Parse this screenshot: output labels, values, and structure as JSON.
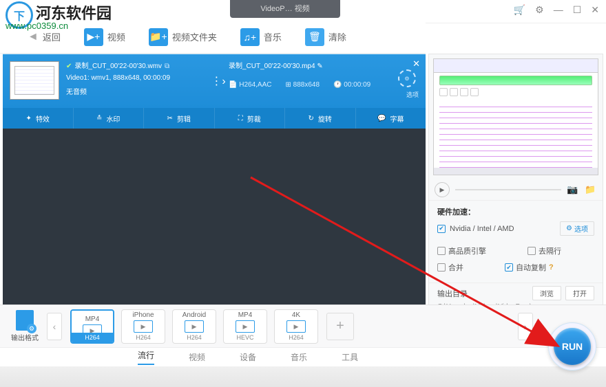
{
  "watermark": {
    "logo_text": "下",
    "title": "河东软件园",
    "url": "www.pc0359.cn"
  },
  "titlebar": {
    "center": "VideoP… 视频"
  },
  "toolbar": {
    "back": "返回",
    "video": "视频",
    "video_folder": "视频文件夹",
    "music": "音乐",
    "clear": "清除"
  },
  "media": {
    "src_name": "录制_CUT_00'22-00'30.wmv",
    "src_info": "Video1: wmv1, 888x648, 00:00:09",
    "src_audio": "无音频",
    "tgt_name": "录制_CUT_00'22-00'30.mp4",
    "tgt_codec": "H264,AAC",
    "tgt_res": "888x648",
    "tgt_dur": "00:00:09",
    "codec_label": "选项",
    "tools": {
      "fx": "特效",
      "wm": "水印",
      "cut": "剪辑",
      "crop": "剪裁",
      "rotate": "旋转",
      "sub": "字幕"
    }
  },
  "right": {
    "hw_title": "硬件加速：",
    "hw_vendor": "Nvidia / Intel / AMD",
    "hw_opt": "选项",
    "opts": {
      "hq": "高品质引擎",
      "deint": "去隔行",
      "merge": "合并",
      "autocopy": "自动复制",
      "q": "?"
    },
    "out_title": "输出目录",
    "out_browse": "浏览",
    "out_open": "打开",
    "out_path": "C:\\Users\\pc\\Videos\\VideoProc\\"
  },
  "formats": {
    "label": "输出格式",
    "items": [
      {
        "top": "MP4",
        "bot": "H264",
        "sel": true
      },
      {
        "top": "iPhone",
        "bot": "H264",
        "sel": false
      },
      {
        "top": "Android",
        "bot": "H264",
        "sel": false
      },
      {
        "top": "MP4",
        "bot": "HEVC",
        "sel": false
      },
      {
        "top": "4K",
        "bot": "H264",
        "sel": false
      }
    ]
  },
  "tabs": {
    "popular": "流行",
    "video": "视频",
    "device": "设备",
    "music": "音乐",
    "tool": "工具"
  },
  "run": "RUN"
}
